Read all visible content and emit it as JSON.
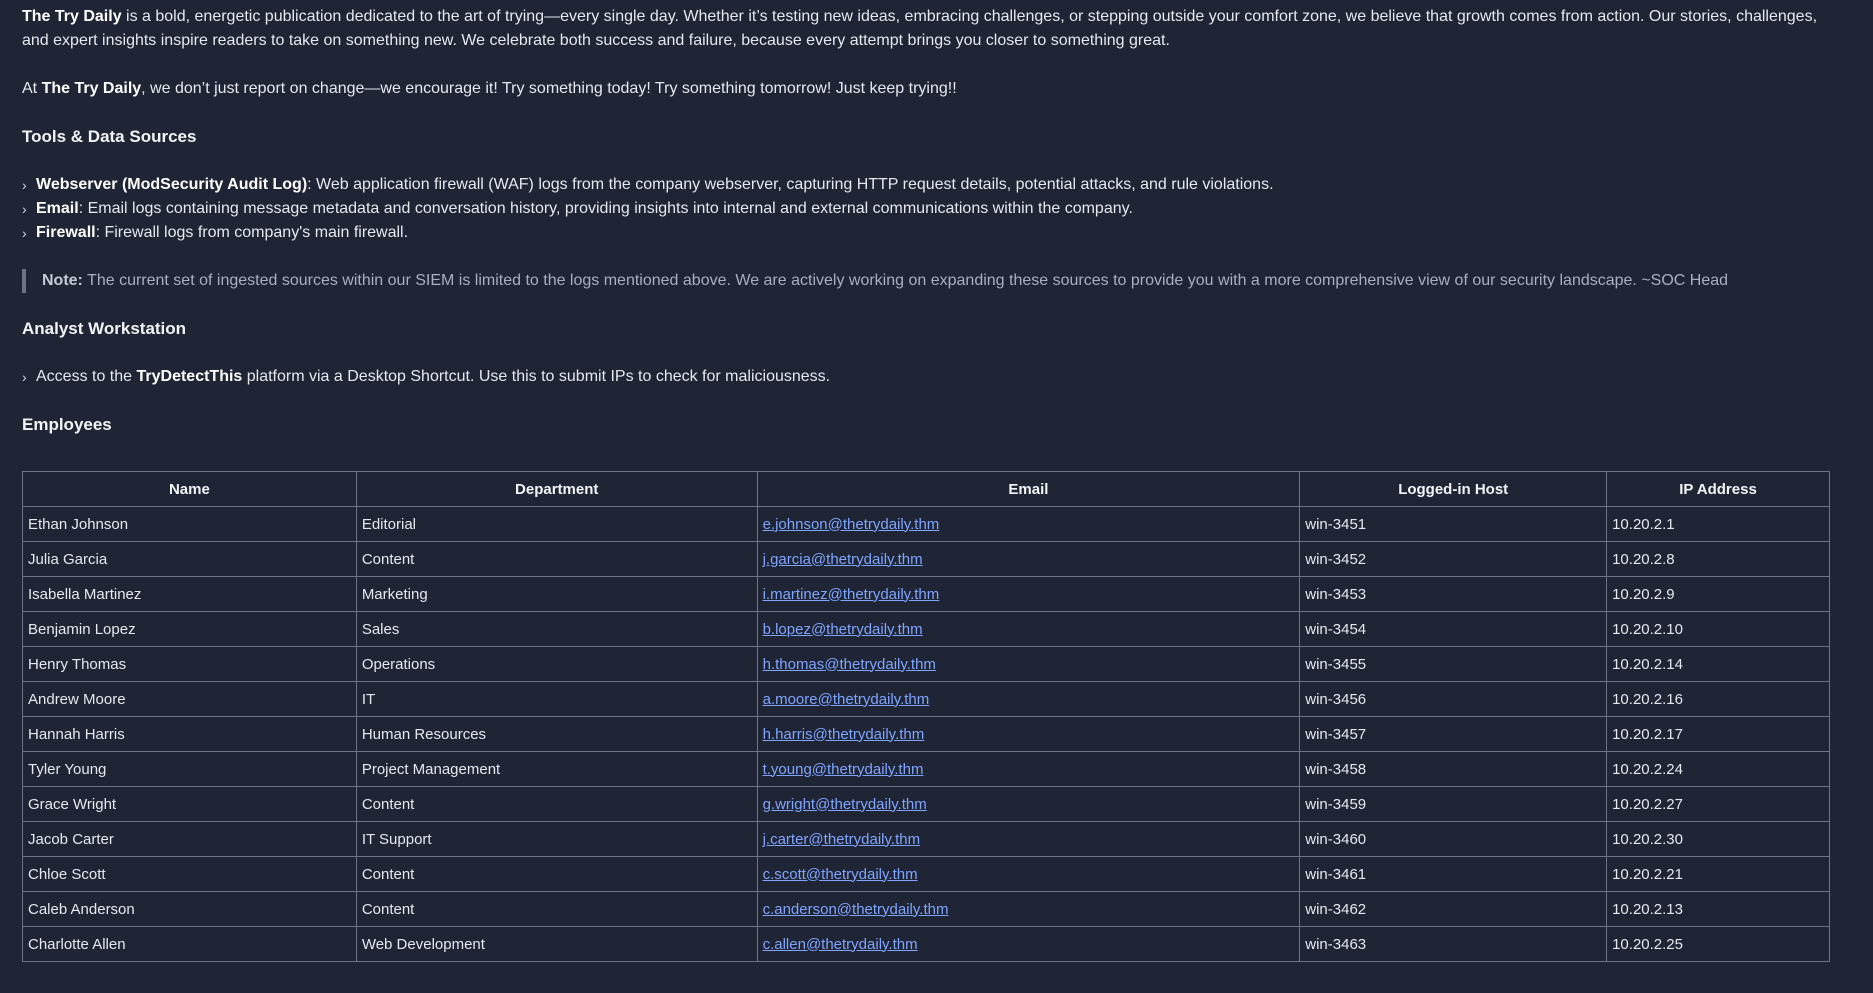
{
  "intro": {
    "brand": "The Try Daily",
    "text": " is a bold, energetic publication dedicated to the art of trying—every single day. Whether it’s testing new ideas, embracing challenges, or stepping outside your comfort zone, we believe that growth comes from action. Our stories, challenges, and expert insights inspire readers to take on something new. We celebrate both success and failure, because every attempt brings you closer to something great.",
    "p2_prefix": "At ",
    "p2_brand": "The Try Daily",
    "p2_text": ", we don’t just report on change—we encourage it! Try something today! Try something tomorrow! Just keep trying!!"
  },
  "tools": {
    "heading": "Tools & Data Sources",
    "items": [
      {
        "name": "Webserver (ModSecurity Audit Log)",
        "desc": ": Web application firewall (WAF) logs from the company webserver, capturing HTTP request details, potential attacks, and rule violations."
      },
      {
        "name": "Email",
        "desc": ": Email logs containing message metadata and conversation history, providing insights into internal and external communications within the company."
      },
      {
        "name": "Firewall",
        "desc": ": Firewall logs from company's main firewall."
      }
    ],
    "note_label": "Note:",
    "note_text": " The current set of ingested sources within our SIEM is limited to the logs mentioned above. We are actively working on expanding these sources to provide you with a more comprehensive view of our security landscape. ~SOC Head"
  },
  "analyst": {
    "heading": "Analyst Workstation",
    "item_prefix": "Access to the ",
    "item_bold": "TryDetectThis",
    "item_suffix": " platform via a Desktop Shortcut. Use this to submit IPs to check for maliciousness."
  },
  "employees": {
    "heading": "Employees",
    "columns": [
      "Name",
      "Department",
      "Email",
      "Logged-in Host",
      "IP Address"
    ],
    "rows": [
      [
        "Ethan Johnson",
        "Editorial",
        "e.johnson@thetrydaily.thm",
        "win-3451",
        "10.20.2.1"
      ],
      [
        "Julia Garcia",
        "Content",
        "j.garcia@thetrydaily.thm",
        "win-3452",
        "10.20.2.8"
      ],
      [
        "Isabella Martinez",
        "Marketing",
        "i.martinez@thetrydaily.thm",
        "win-3453",
        "10.20.2.9"
      ],
      [
        "Benjamin Lopez",
        "Sales",
        "b.lopez@thetrydaily.thm",
        "win-3454",
        "10.20.2.10"
      ],
      [
        "Henry Thomas",
        "Operations",
        "h.thomas@thetrydaily.thm",
        "win-3455",
        "10.20.2.14"
      ],
      [
        "Andrew Moore",
        "IT",
        "a.moore@thetrydaily.thm",
        "win-3456",
        "10.20.2.16"
      ],
      [
        "Hannah Harris",
        "Human Resources",
        "h.harris@thetrydaily.thm",
        "win-3457",
        "10.20.2.17"
      ],
      [
        "Tyler Young",
        "Project Management",
        "t.young@thetrydaily.thm",
        "win-3458",
        "10.20.2.24"
      ],
      [
        "Grace Wright",
        "Content",
        "g.wright@thetrydaily.thm",
        "win-3459",
        "10.20.2.27"
      ],
      [
        "Jacob Carter",
        "IT Support",
        "j.carter@thetrydaily.thm",
        "win-3460",
        "10.20.2.30"
      ],
      [
        "Chloe Scott",
        "Content",
        "c.scott@thetrydaily.thm",
        "win-3461",
        "10.20.2.21"
      ],
      [
        "Caleb Anderson",
        "Content",
        "c.anderson@thetrydaily.thm",
        "win-3462",
        "10.20.2.13"
      ],
      [
        "Charlotte Allen",
        "Web Development",
        "c.allen@thetrydaily.thm",
        "win-3463",
        "10.20.2.25"
      ]
    ]
  },
  "colors": {
    "background": "#1f2535",
    "link": "#7fa5ff",
    "border": "#6e7485"
  }
}
